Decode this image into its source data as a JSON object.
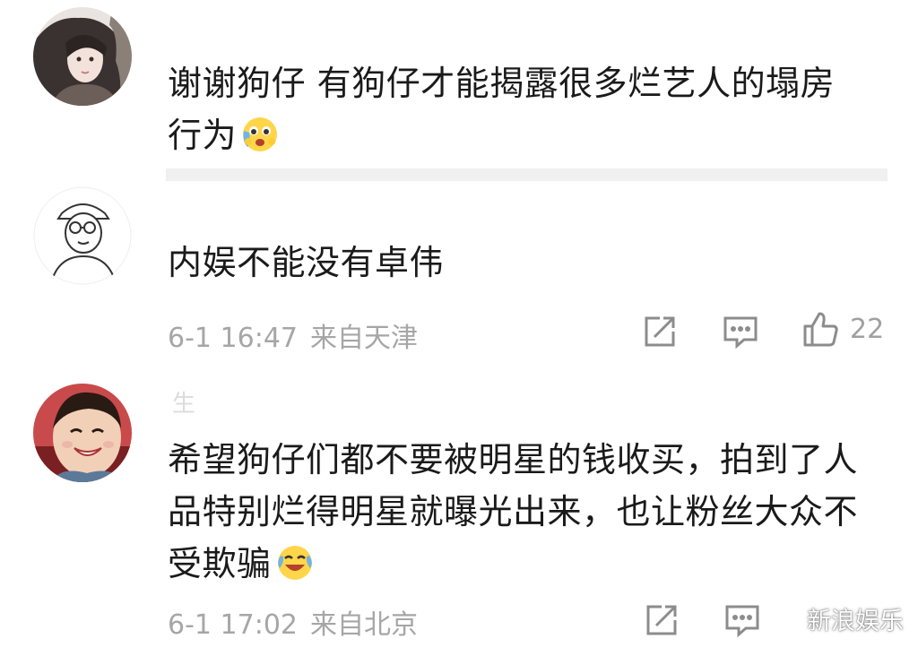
{
  "comments": [
    {
      "name": "",
      "text_line1": "谢谢狗仔 有狗仔才能揭露很多烂艺人的塌房",
      "text_line2": "行为",
      "emoji": "crying-laughing-face-emoji"
    },
    {
      "text": "内娱不能没有卓伟",
      "time": "6-1 16:47",
      "location": "来自天津",
      "likes": "22"
    },
    {
      "name": "生",
      "text_line1": "希望狗仔们都不要被明星的钱收买，拍到了人",
      "text_line2": "品特别烂得明星就曝光出来，也让粉丝大众不",
      "text_line3": "受欺骗",
      "emoji": "laughing-tears-emoji",
      "time": "6-1 17:02",
      "location": "来自北京"
    }
  ],
  "watermark": {
    "text": "新浪娱乐",
    "icon": "wechat-icon"
  },
  "icons": [
    "share-icon",
    "comment-icon",
    "like-icon"
  ],
  "colors": {
    "text": "#1a1a1a",
    "meta": "#a6a6a6",
    "divider": "#f0f0f0"
  }
}
